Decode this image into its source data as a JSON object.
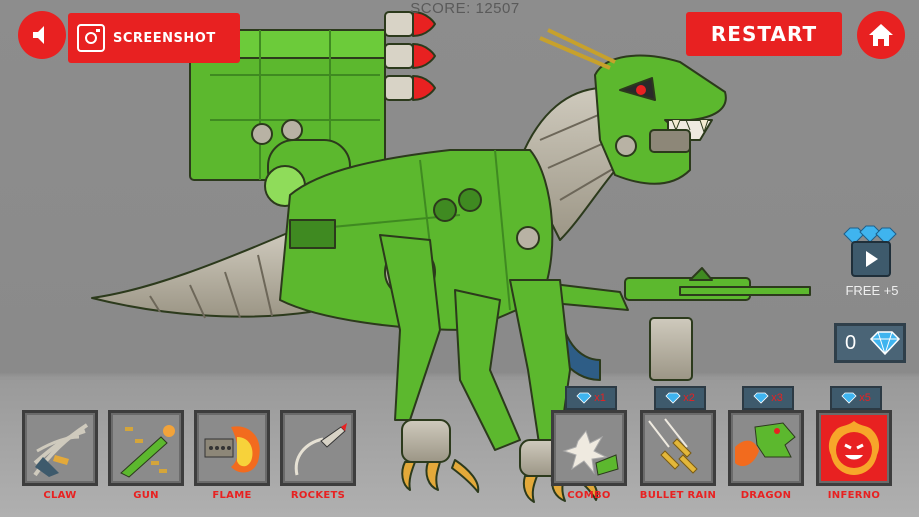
{
  "hud": {
    "score_label": "SCORE:",
    "score_value": "12507",
    "screenshot_label": "SCREENSHOT",
    "restart_label": "RESTART",
    "free_reward_label": "FREE +5",
    "gem_count": "0"
  },
  "weapons": [
    {
      "label": "CLAW",
      "icon": "claw-icon"
    },
    {
      "label": "GUN",
      "icon": "gun-icon"
    },
    {
      "label": "FLAME",
      "icon": "flame-icon"
    },
    {
      "label": "ROCKETS",
      "icon": "rocket-icon"
    }
  ],
  "specials": [
    {
      "label": "COMBO",
      "cost": "x1",
      "icon": "combo-icon"
    },
    {
      "label": "BULLET RAIN",
      "cost": "x2",
      "icon": "bullet-rain-icon"
    },
    {
      "label": "DRAGON",
      "cost": "x3",
      "icon": "dragon-icon"
    },
    {
      "label": "INFERNO",
      "cost": "x5",
      "icon": "inferno-icon"
    }
  ],
  "colors": {
    "button_red": "#e82121",
    "robot_green": "#5cb82e",
    "robot_dark_green": "#3f8a21",
    "metal_grey": "#b8b2a4",
    "panel_blue": "#3e5a6c",
    "gem_blue": "#3fb4ef"
  }
}
